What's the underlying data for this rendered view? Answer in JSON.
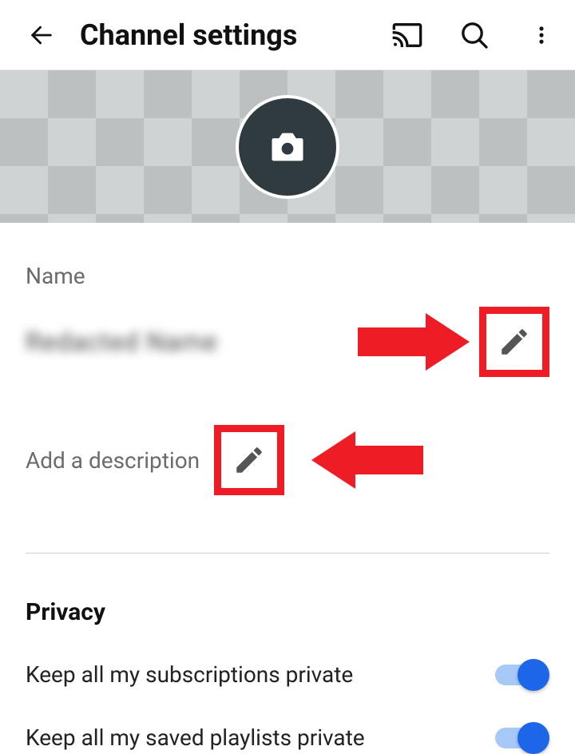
{
  "header": {
    "title": "Channel settings"
  },
  "profile": {
    "name_label": "Name",
    "name_value": "Redacted Name",
    "description_label": "Add a description"
  },
  "privacy": {
    "title": "Privacy",
    "subscriptions_label": "Keep all my subscriptions private",
    "subscriptions_on": true,
    "playlists_label": "Keep all my saved playlists private",
    "playlists_on": true
  },
  "colors": {
    "accent": "#ee1c25",
    "switch_on": "#1d66ea"
  }
}
